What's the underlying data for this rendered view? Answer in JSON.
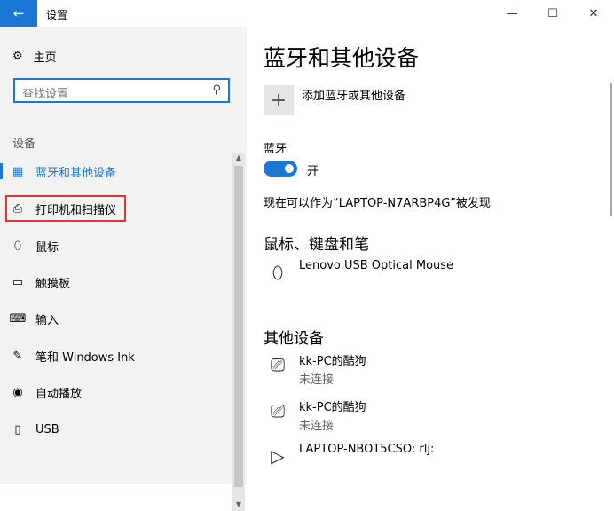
{
  "window": {
    "title": "设置",
    "back_icon": "back-arrow-icon",
    "minimize": "—",
    "maximize": "☐",
    "close": "✕"
  },
  "sidebar": {
    "home_label": "主页",
    "search_placeholder": "查找设置",
    "section_label": "设备",
    "items": [
      {
        "label": "蓝牙和其他设备",
        "icon": "bluetooth-devices-icon",
        "glyph": "▦"
      },
      {
        "label": "打印机和扫描仪",
        "icon": "printer-icon",
        "glyph": "⎙"
      },
      {
        "label": "鼠标",
        "icon": "mouse-icon",
        "glyph": "⬯"
      },
      {
        "label": "触摸板",
        "icon": "touchpad-icon",
        "glyph": "▭"
      },
      {
        "label": "输入",
        "icon": "keyboard-icon",
        "glyph": "⌨"
      },
      {
        "label": "笔和 Windows Ink",
        "icon": "pen-icon",
        "glyph": "✎"
      },
      {
        "label": "自动播放",
        "icon": "autoplay-icon",
        "glyph": "◉"
      },
      {
        "label": "USB",
        "icon": "usb-icon",
        "glyph": "▯"
      }
    ]
  },
  "main": {
    "title": "蓝牙和其他设备",
    "add_device_label": "添加蓝牙或其他设备",
    "bluetooth_heading": "蓝牙",
    "bluetooth_toggle_label": "开",
    "bluetooth_on": true,
    "discoverable_text": "现在可以作为“LAPTOP-N7ARBP4G”被发现",
    "mouse_section": "鼠标、键盘和笔",
    "mouse_device": "Lenovo USB Optical Mouse",
    "other_section": "其他设备",
    "other_devices": [
      {
        "name": "kk-PC的酷狗",
        "status": "未连接"
      },
      {
        "name": "kk-PC的酷狗",
        "status": "未连接"
      },
      {
        "name": "LAPTOP-NBOT5CSO: rlj:",
        "status": ""
      }
    ]
  },
  "colors": {
    "accent": "#1a78d4",
    "highlight": "#e0372d",
    "sidebar_bg": "#f2f2f2"
  }
}
